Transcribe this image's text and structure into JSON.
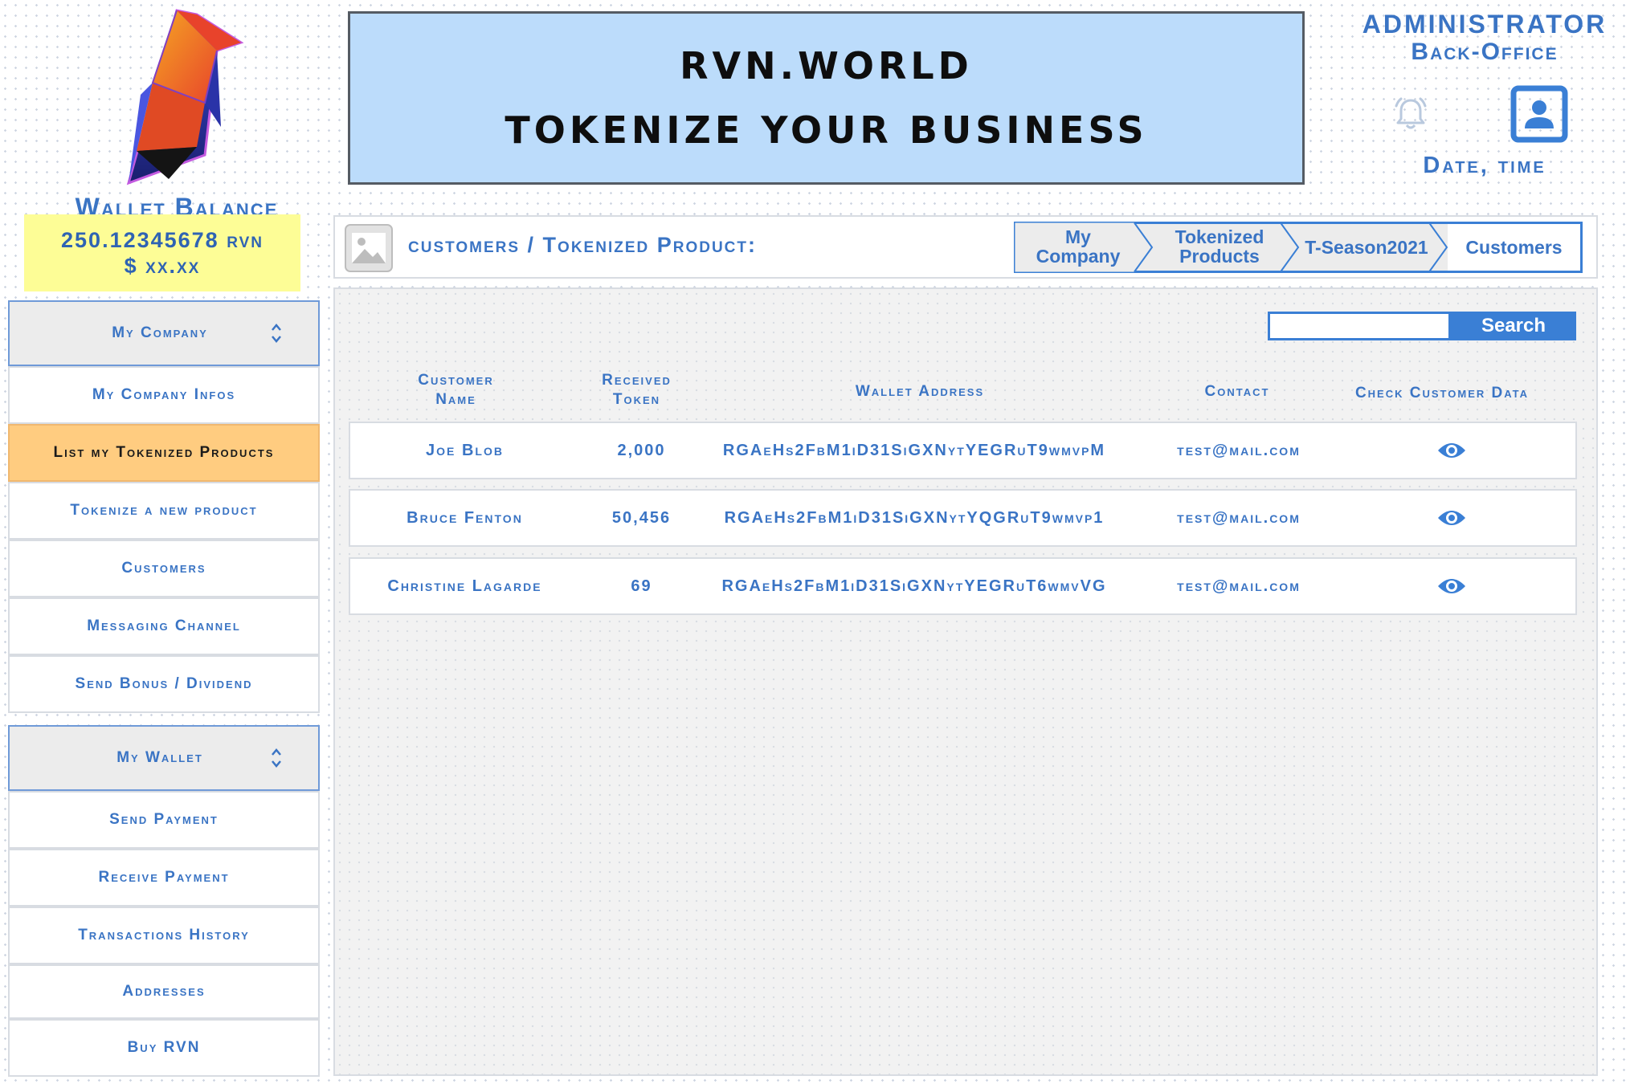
{
  "brand": {
    "logo_icon": "raven-logo-icon"
  },
  "wallet": {
    "title": "Wallet Balance",
    "rvn": "250.12345678 rvn",
    "usd": "$ xx.xx"
  },
  "banner": {
    "line1": "RVN.WORLD",
    "line2": "TOKENIZE YOUR BUSINESS"
  },
  "admin": {
    "title": "ADMINISTRATOR",
    "subtitle": "Back-Office",
    "datetime": "Date, time"
  },
  "header": {
    "title": "customers / Tokenized Product:",
    "breadcrumb": [
      {
        "label_l1": "My",
        "label_l2": "Company"
      },
      {
        "label_l1": "Tokenized",
        "label_l2": "Products"
      },
      {
        "label": "T-Season2021"
      },
      {
        "label": "Customers"
      }
    ]
  },
  "sidebar": {
    "company_group": "My Company",
    "company_items": [
      "My Company Infos",
      "List my Tokenized Products",
      "Tokenize a new product",
      "Customers",
      "Messaging Channel",
      "Send Bonus / Dividend"
    ],
    "wallet_group": "My Wallet",
    "wallet_items": [
      "Send Payment",
      "Receive Payment",
      "Transactions History",
      "Addresses",
      "Buy RVN"
    ]
  },
  "search": {
    "button": "Search",
    "placeholder": ""
  },
  "table": {
    "headers": {
      "name_l1": "Customer",
      "name_l2": "Name",
      "token_l1": "Received",
      "token_l2": "Token",
      "wallet": "Wallet Address",
      "contact": "Contact",
      "check": "Check Customer Data"
    },
    "rows": [
      {
        "name": "Joe Blob",
        "token": "2,000",
        "wallet": "RGAeHs2FbM1iD31SiGXNytYEGRuT9wmvpM",
        "contact": "test@mail.com"
      },
      {
        "name": "Bruce Fenton",
        "token": "50,456",
        "wallet": "RGAeHs2FbM1iD31SiGXNytYQGRuT9wmvp1",
        "contact": "test@mail.com"
      },
      {
        "name": "Christine Lagarde",
        "token": "69",
        "wallet": "RGAeHs2FbM1iD31SiGXNytYEGRuT6wmvVG",
        "contact": "test@mail.com"
      }
    ]
  },
  "colors": {
    "accent": "#3a74c4",
    "banner": "#bcdcfb",
    "active": "#ffcc80",
    "balance": "#fdfd96"
  }
}
